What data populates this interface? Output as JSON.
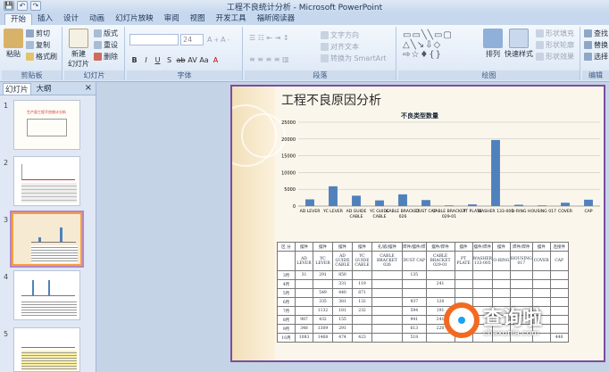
{
  "window": {
    "title": "工程不良统计分析 - Microsoft PowerPoint"
  },
  "quick_access": {
    "save": "💾",
    "undo": "↶",
    "redo": "↷"
  },
  "tabs": [
    "开始",
    "插入",
    "设计",
    "动画",
    "幻灯片放映",
    "审阅",
    "视图",
    "开发工具",
    "福昕阅读器"
  ],
  "ribbon": {
    "clipboard": {
      "label": "剪贴板",
      "paste": "粘贴",
      "cut": "剪切",
      "copy": "复制",
      "format_painter": "格式刷"
    },
    "slides": {
      "label": "幻灯片",
      "new_slide_line1": "新建",
      "new_slide_line2": "幻灯片",
      "layout": "版式",
      "reset": "重设",
      "delete": "删除"
    },
    "font": {
      "label": "字体",
      "size": "24"
    },
    "paragraph": {
      "label": "段落",
      "text_direction": "文字方向",
      "align_text": "对齐文本",
      "smartart": "转换为 SmartArt"
    },
    "drawing": {
      "label": "绘图",
      "arrange": "排列",
      "quick_styles": "快速样式",
      "shape_fill": "形状填充",
      "shape_outline": "形状轮廓",
      "shape_effects": "形状效果"
    },
    "editing": {
      "label": "编辑",
      "find": "查找",
      "replace": "替换",
      "select": "选择"
    }
  },
  "panel": {
    "tab_slides": "幻灯片",
    "tab_outline": "大纲",
    "close": "×",
    "numbers": [
      "1",
      "2",
      "3",
      "4",
      "5"
    ],
    "thumb1_title": "生产部工程不良统计分析"
  },
  "slide": {
    "title": "工程不良原因分析",
    "chart_data": {
      "type": "bar",
      "title": "不良类型数量",
      "categories": [
        "AD LEVER",
        "YC LEVER",
        "AD GUIDE CABLE",
        "YC GUIDE CABLE",
        "CABLE BRACKET 026",
        "DUST CAP",
        "CABLE BRACKET 029-01",
        "PT PLATE",
        "WASHER 133-005",
        "O-RING",
        "HOUSING 017",
        "COVER",
        "CAP"
      ],
      "values": [
        2000,
        5900,
        3100,
        1700,
        3500,
        1800,
        200,
        500,
        19700,
        400,
        200,
        1000,
        1900
      ],
      "ylim": [
        0,
        25000
      ],
      "yticks": [
        "0",
        "5000",
        "10000",
        "15000",
        "20000",
        "25000"
      ],
      "grid": true,
      "color": "#4f81bd"
    },
    "table": {
      "header": [
        "区 分",
        "摆件",
        "摆件",
        "摆件",
        "摆件",
        "孔/嵌/摆件",
        "焊件/摆件/焊",
        "摆件/焊件",
        "摆件",
        "摆件/焊件",
        "摆件",
        "焊件/焊件",
        "摆件",
        "连接件"
      ],
      "subheader": [
        "",
        "AD LEVER",
        "YC LEVER",
        "AD GUIDE CABLE",
        "YC GUIDE CABLE",
        "CABLE BRACKET 026",
        "DUST CAP",
        "CABLE BRACKET 029-01",
        "PT PLATE",
        "WASHER 133-005",
        "O-RING",
        "HOUSING 017",
        "COVER",
        "CAP"
      ],
      "rows": [
        [
          "3月",
          "31",
          "291",
          "850",
          "",
          "",
          "135",
          "",
          "",
          "",
          "",
          "",
          "",
          ""
        ],
        [
          "4月",
          "",
          "",
          "331",
          "119",
          "",
          "",
          "241",
          "",
          "",
          "",
          "",
          "",
          ""
        ],
        [
          "5月",
          "",
          "549",
          "440",
          "871",
          "",
          "",
          "",
          "",
          "",
          "",
          "",
          "",
          ""
        ],
        [
          "6月",
          "",
          "335",
          "381",
          "132",
          "",
          "937",
          "120",
          "",
          "",
          "",
          "",
          "",
          ""
        ],
        [
          "7月",
          "",
          "1132",
          "181",
          "232",
          "",
          "594",
          "191",
          "",
          "",
          "",
          "",
          "",
          ""
        ],
        [
          "8月",
          "987",
          "432",
          "155",
          "",
          "",
          "941",
          "241",
          "",
          "",
          "",
          "",
          "",
          ""
        ],
        [
          "9月",
          "348",
          "1309",
          "291",
          "",
          "",
          "613",
          "220",
          "",
          "",
          "",
          "",
          "",
          ""
        ],
        [
          "10月",
          "1083",
          "1468",
          "474",
          "423",
          "",
          "518",
          "",
          "",
          "",
          "",
          "",
          "",
          "440"
        ]
      ]
    }
  },
  "watermark": {
    "text": "查询啦",
    "url": "chaxunla.com"
  }
}
